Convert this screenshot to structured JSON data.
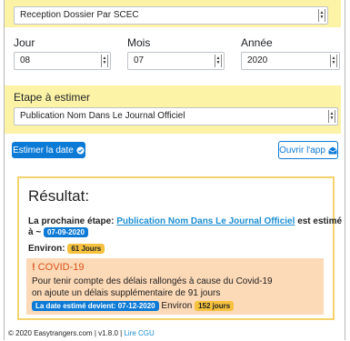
{
  "form": {
    "procedure_select": "Reception Dossier Par SCEC",
    "day_label": "Jour",
    "month_label": "Mois",
    "year_label": "Année",
    "day_value": "08",
    "month_value": "07",
    "year_value": "2020",
    "step_label": "Etape à estimer",
    "step_value": "Publication Nom Dans Le Journal Officiel"
  },
  "buttons": {
    "estimate": "Estimer la date",
    "open_app": "Ouvrir l'app"
  },
  "result": {
    "title": "Résultat:",
    "next_step_prefix": "La prochaine étape:",
    "next_step_link": "Publication Nom Dans Le Journal Officiel",
    "next_step_suffix": "est estimé",
    "approx": "à ~",
    "estimated_date": "07-09-2020",
    "environ_label": "Environ:",
    "environ_days": "61 Jours"
  },
  "covid": {
    "title": "COVID-19",
    "line1": "Pour tenir compte des délais rallongés à cause du Covid-19",
    "line2": "on ajoute un délais supplémentaire de 91 jours",
    "new_date_badge": "La date estimé devient: 07-12-2020",
    "environ_label": "Environ",
    "environ_days": "152 jours"
  },
  "footer": {
    "copyright": "© 2020 Easytrangers.com | v1.8.0 |",
    "cgu_link": "Lire CGU"
  },
  "colors": {
    "primary": "#0d7bd6",
    "highlight_yellow": "#fdf3a6",
    "alert_bg": "#fcd9b7",
    "badge_yellow": "#f6c23e"
  }
}
